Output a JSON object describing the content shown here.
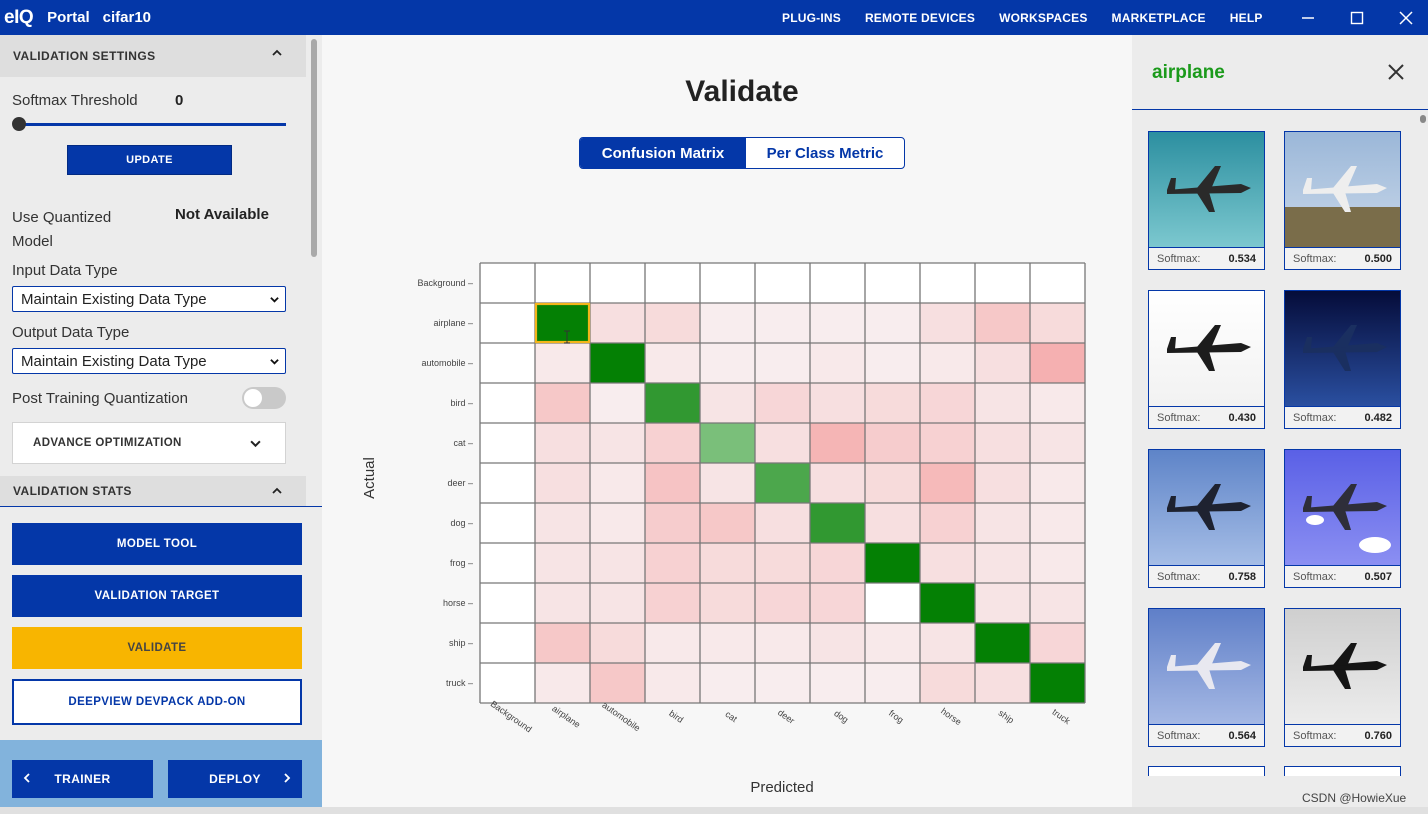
{
  "topbar": {
    "logo": "eIQ",
    "portal": "Portal",
    "project": "cifar10",
    "nav": [
      "PLUG-INS",
      "REMOTE DEVICES",
      "WORKSPACES",
      "MARKETPLACE",
      "HELP"
    ],
    "window_controls": [
      "minimize-icon",
      "maximize-icon",
      "close-icon"
    ]
  },
  "left": {
    "validation_settings_title": "VALIDATION SETTINGS",
    "softmax_label": "Softmax Threshold",
    "softmax_value": "0",
    "update_label": "UPDATE",
    "quantized_label": "Use Quantized Model",
    "quantized_value": "Not Available",
    "input_type_label": "Input Data Type",
    "input_type_value": "Maintain Existing Data Type",
    "output_type_label": "Output Data Type",
    "output_type_value": "Maintain Existing Data Type",
    "ptq_label": "Post Training Quantization",
    "ptq_enabled": false,
    "advance_label": "ADVANCE OPTIMIZATION",
    "validation_stats_title": "VALIDATION STATS",
    "model_tool_label": "MODEL TOOL",
    "validation_target_label": "VALIDATION TARGET",
    "validate_label": "VALIDATE",
    "deepview_label": "DEEPVIEW DEVPACK ADD-ON",
    "trainer_label": "TRAINER",
    "deploy_label": "DEPLOY"
  },
  "center": {
    "title": "Validate",
    "tab_active": "Confusion Matrix",
    "tab_inactive": "Per Class Metric"
  },
  "chart_data": {
    "type": "heatmap",
    "xlabel": "Predicted",
    "ylabel": "Actual",
    "x_categories": [
      "Background",
      "airplane",
      "automobile",
      "bird",
      "cat",
      "deer",
      "dog",
      "frog",
      "horse",
      "ship",
      "truck"
    ],
    "y_categories": [
      "Background",
      "airplane",
      "automobile",
      "bird",
      "cat",
      "deer",
      "dog",
      "frog",
      "horse",
      "ship",
      "truck"
    ],
    "selected_cell": [
      "airplane",
      "airplane"
    ],
    "diagonal_intensity": [
      0,
      1.0,
      1.0,
      0.75,
      0.35,
      0.6,
      0.75,
      1.0,
      1.0,
      1.0,
      1.0
    ],
    "offdiag_intensity": [
      [
        0,
        0,
        0,
        0,
        0,
        0,
        0,
        0,
        0,
        0,
        0
      ],
      [
        0,
        0,
        0.2,
        0.25,
        0.05,
        0.05,
        0.05,
        0.05,
        0.2,
        0.45,
        0.25
      ],
      [
        0,
        0.1,
        0,
        0.1,
        0.05,
        0.05,
        0.1,
        0.05,
        0.1,
        0.2,
        0.7
      ],
      [
        0,
        0.45,
        0.05,
        0,
        0.15,
        0.3,
        0.2,
        0.25,
        0.3,
        0.15,
        0.1
      ],
      [
        0,
        0.2,
        0.15,
        0.35,
        0,
        0.2,
        0.65,
        0.4,
        0.35,
        0.2,
        0.15
      ],
      [
        0,
        0.2,
        0.1,
        0.5,
        0.15,
        0,
        0.2,
        0.25,
        0.6,
        0.2,
        0.1
      ],
      [
        0,
        0.15,
        0.1,
        0.4,
        0.45,
        0.2,
        0,
        0.2,
        0.35,
        0.15,
        0.1
      ],
      [
        0,
        0.15,
        0.15,
        0.35,
        0.25,
        0.25,
        0.3,
        0,
        0.2,
        0.15,
        0.1
      ],
      [
        0,
        0.15,
        0.15,
        0.35,
        0.25,
        0.3,
        0.3,
        0,
        0,
        0.15,
        0.15
      ],
      [
        0,
        0.45,
        0.25,
        0.1,
        0.1,
        0.1,
        0.15,
        0.1,
        0.15,
        0,
        0.3
      ],
      [
        0,
        0.1,
        0.45,
        0.1,
        0.05,
        0.05,
        0.05,
        0.05,
        0.25,
        0.2,
        0
      ]
    ]
  },
  "right": {
    "title": "airplane",
    "softmax_label": "Softmax",
    "samples": [
      {
        "score": "0.534",
        "theme": "teal"
      },
      {
        "score": "0.500",
        "theme": "field"
      },
      {
        "score": "0.430",
        "theme": "white"
      },
      {
        "score": "0.482",
        "theme": "navy"
      },
      {
        "score": "0.758",
        "theme": "steel"
      },
      {
        "score": "0.507",
        "theme": "violet"
      },
      {
        "score": "0.564",
        "theme": "sky"
      },
      {
        "score": "0.760",
        "theme": "gray"
      }
    ]
  },
  "watermark": "CSDN @HowieXue"
}
